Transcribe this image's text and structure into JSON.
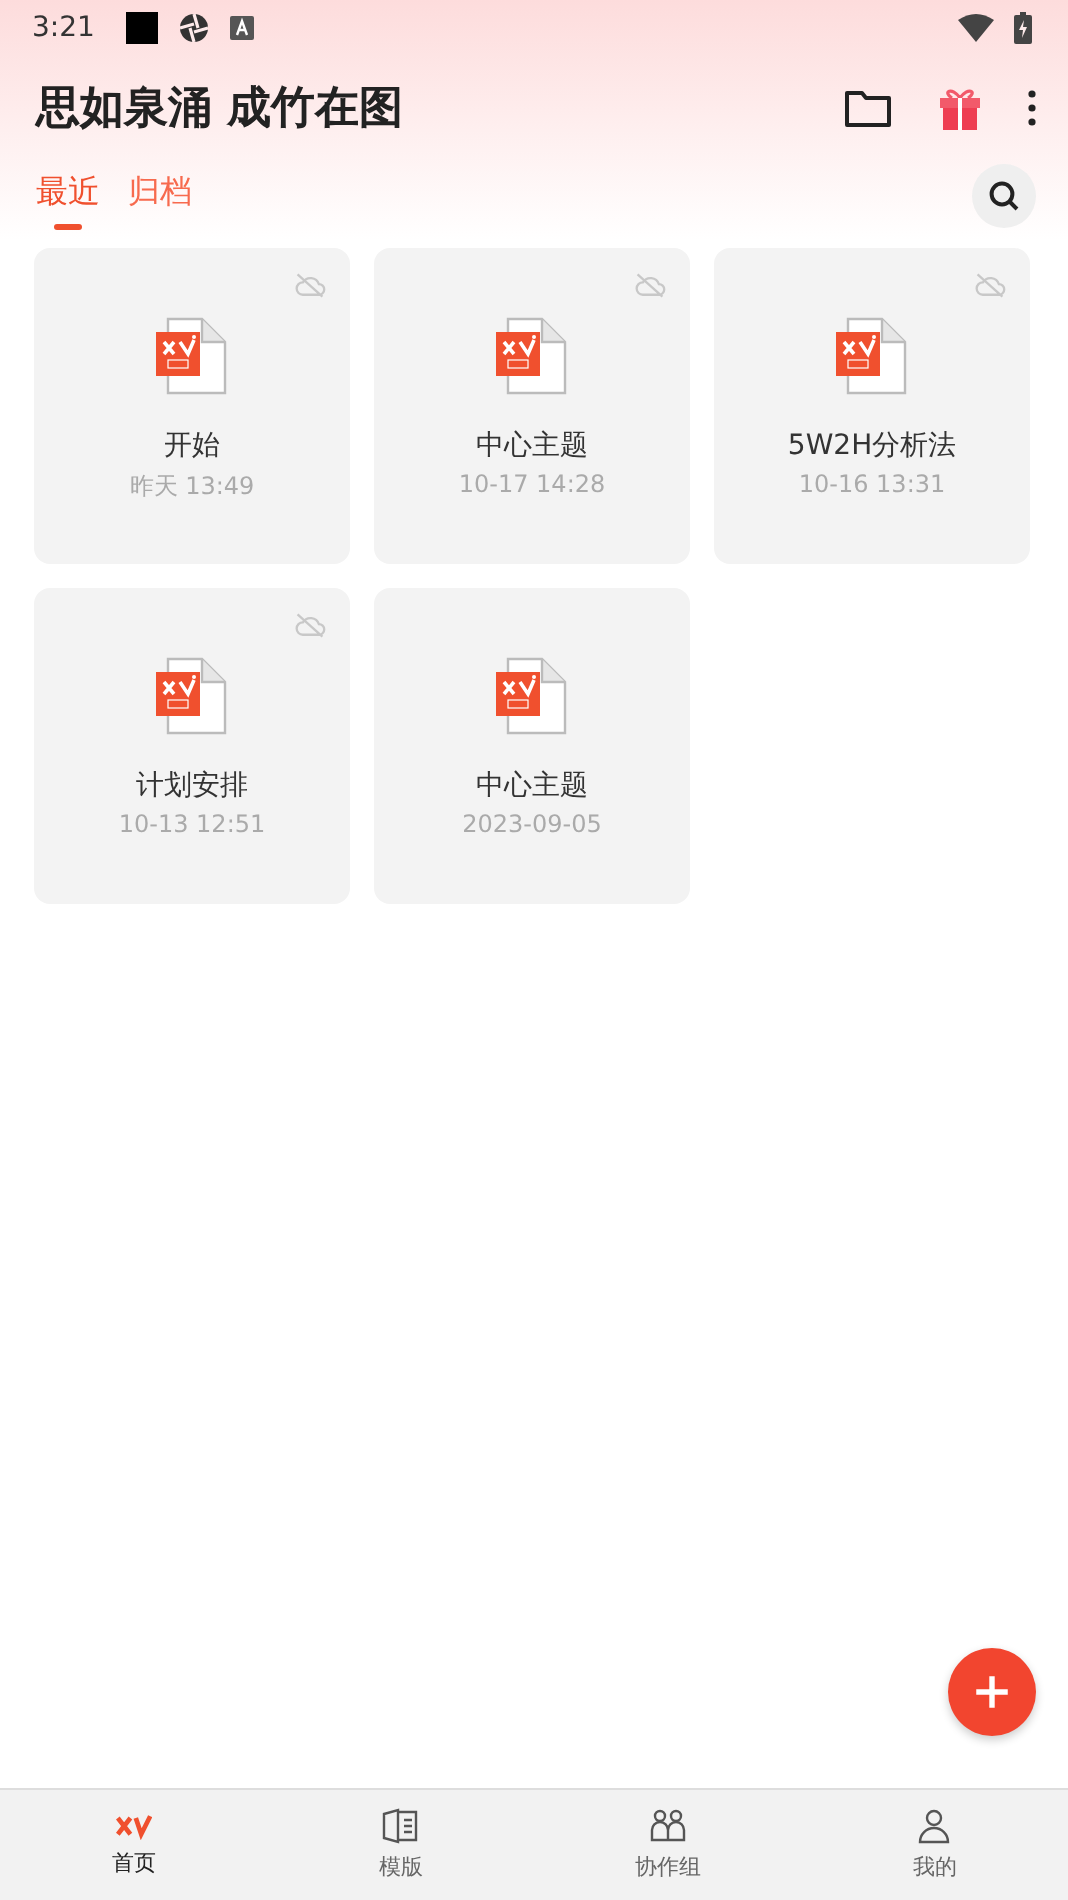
{
  "status_bar": {
    "time": "3:21"
  },
  "header": {
    "title": "思如泉涌 成竹在图"
  },
  "tabs": [
    {
      "label": "最近",
      "selected": true
    },
    {
      "label": "归档",
      "selected": false
    }
  ],
  "files": [
    {
      "name": "开始",
      "time": "昨天 13:49",
      "cloud_off": true
    },
    {
      "name": "中心主题",
      "time": "10-17 14:28",
      "cloud_off": true
    },
    {
      "name": "5W2H分析法",
      "time": "10-16 13:31",
      "cloud_off": true
    },
    {
      "name": "计划安排",
      "time": "10-13 12:51",
      "cloud_off": true
    },
    {
      "name": "中心主题",
      "time": "2023-09-05",
      "cloud_off": false
    }
  ],
  "bottom_nav": [
    {
      "label": "首页",
      "kind": "home",
      "selected": true
    },
    {
      "label": "模版",
      "kind": "template",
      "selected": false
    },
    {
      "label": "协作组",
      "kind": "team",
      "selected": false
    },
    {
      "label": "我的",
      "kind": "me",
      "selected": false
    }
  ]
}
